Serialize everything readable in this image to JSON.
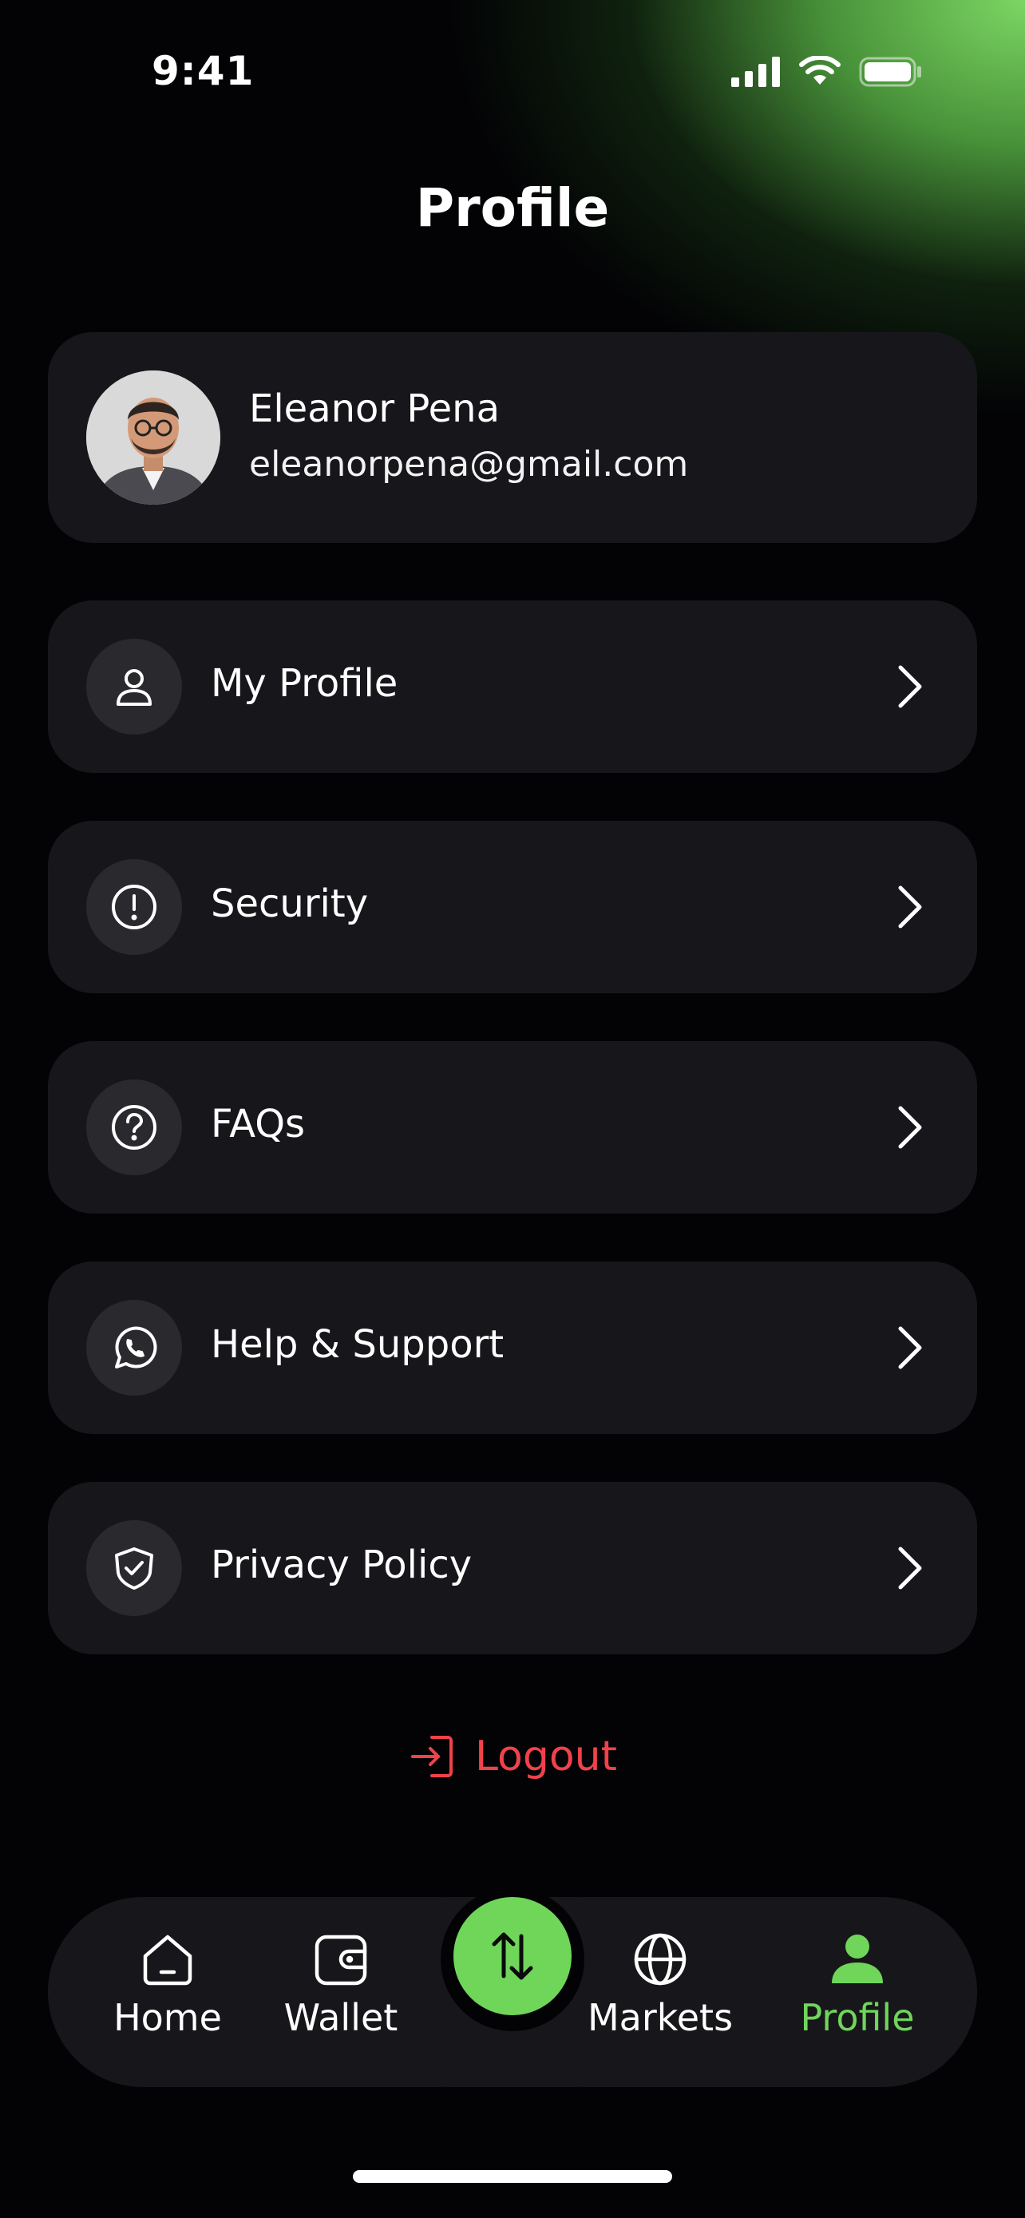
{
  "status_bar": {
    "time": "9:41"
  },
  "header": {
    "title": "Profile"
  },
  "user": {
    "name": "Eleanor Pena",
    "email": "eleanorpena@gmail.com"
  },
  "menu": [
    {
      "label": "My Profile",
      "icon": "user-icon"
    },
    {
      "label": "Security",
      "icon": "alert-circle-icon"
    },
    {
      "label": "FAQs",
      "icon": "question-circle-icon"
    },
    {
      "label": "Help & Support",
      "icon": "whatsapp-icon"
    },
    {
      "label": "Privacy Policy",
      "icon": "shield-check-icon"
    }
  ],
  "logout": {
    "label": "Logout",
    "icon": "logout-icon",
    "color": "#f0424a"
  },
  "tabbar": {
    "tabs": [
      {
        "label": "Home",
        "icon": "home-icon"
      },
      {
        "label": "Wallet",
        "icon": "wallet-icon"
      },
      {
        "label": "Markets",
        "icon": "globe-icon"
      },
      {
        "label": "Profile",
        "icon": "profile-icon",
        "active": true
      }
    ],
    "center_action": {
      "icon": "swap-arrows-icon"
    },
    "active_color": "#6fd65a"
  },
  "colors": {
    "accent": "#6fd65a",
    "card": "#17171b",
    "background": "#030305",
    "danger": "#f0424a"
  }
}
